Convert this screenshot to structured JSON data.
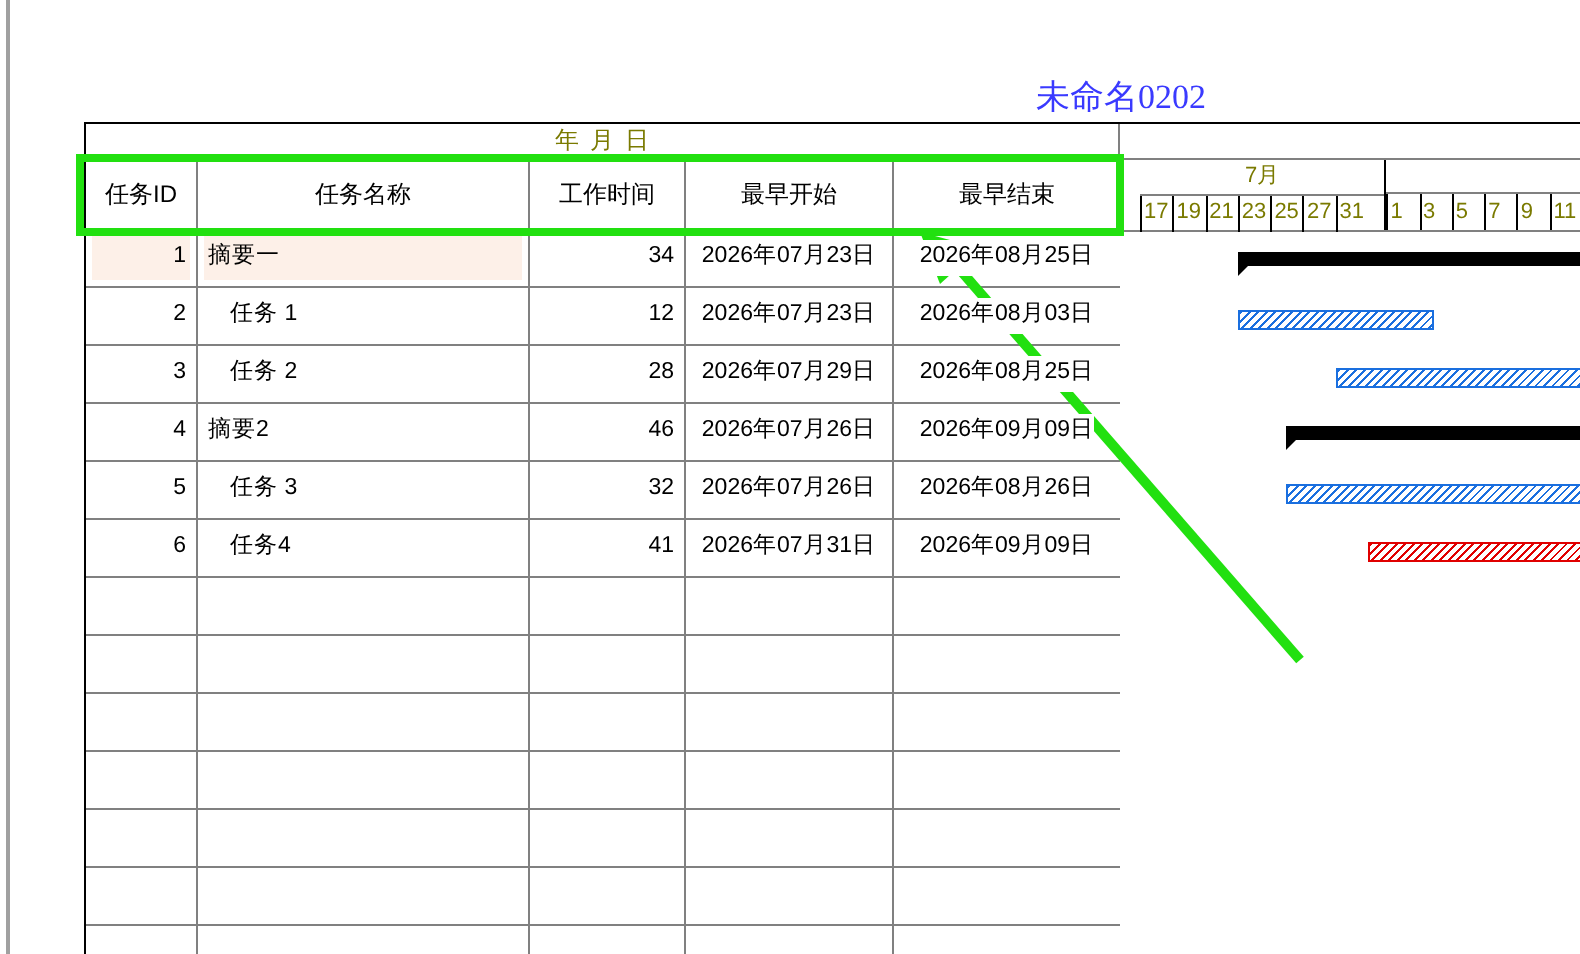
{
  "title": "未命名0202",
  "date_header": "年 月 日",
  "columns": [
    "任务ID",
    "任务名称",
    "工作时间",
    "最早开始",
    "最早结束"
  ],
  "tasks": [
    {
      "id": "1",
      "name": "摘要一",
      "duration": "34",
      "start": "2026年07月23日",
      "finish": "2026年08月25日",
      "selected": true,
      "children": [
        {
          "id": "2",
          "name": "任务 1",
          "duration": "12",
          "start": "2026年07月23日",
          "finish": "2026年08月03日",
          "selected": false,
          "color": "#1a6fdf"
        },
        {
          "id": "3",
          "name": "任务 2",
          "duration": "28",
          "start": "2026年07月29日",
          "finish": "2026年08月25日",
          "selected": false,
          "color": "#1a6fdf"
        }
      ]
    },
    {
      "id": "4",
      "name": "摘要2",
      "duration": "46",
      "start": "2026年07月26日",
      "finish": "2026年09月09日",
      "selected": false,
      "children": [
        {
          "id": "5",
          "name": "任务 3",
          "duration": "32",
          "start": "2026年07月26日",
          "finish": "2026年08月26日",
          "selected": false,
          "color": "#1a6fdf"
        },
        {
          "id": "6",
          "name": "任务4",
          "duration": "41",
          "start": "2026年07月31日",
          "finish": "2026年09月09日",
          "selected": false,
          "color": "#e00000"
        }
      ]
    }
  ],
  "timeline": [
    {
      "label": "7月",
      "days": [
        "17",
        "19",
        "21",
        "23",
        "25",
        "27",
        "31"
      ]
    },
    {
      "days": [
        "1",
        "3",
        "5",
        "7",
        "9",
        "11"
      ]
    }
  ]
}
